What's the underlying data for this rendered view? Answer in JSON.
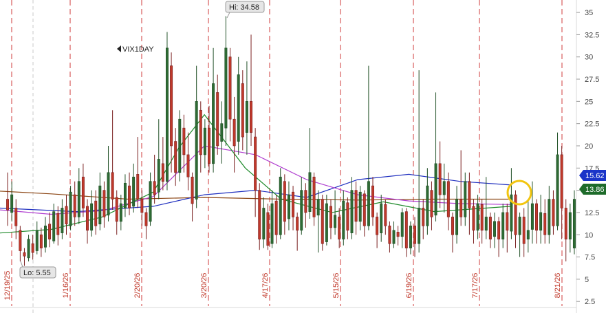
{
  "chart_data": {
    "type": "candlestick",
    "symbol": "VIX1DAY",
    "y_axis": {
      "ticks": [
        "35",
        "32.5",
        "30",
        "27.5",
        "25",
        "22.5",
        "20",
        "17.5",
        "15",
        "12.5",
        "10",
        "7.5",
        "5",
        "2.5"
      ],
      "ylim": [
        1.2,
        36.4
      ]
    },
    "date_markers": [
      "12/19/25",
      "1/16/26",
      "2/20/26",
      "3/20/26",
      "4/17/26",
      "5/15/26",
      "6/19/26",
      "7/17/26",
      "8/21/26"
    ],
    "hi_label": "Hi: 34.58",
    "lo_label": "Lo: 5.55",
    "price_tags": [
      {
        "text": "15.62",
        "value": 15.62,
        "color": "#1a35c8"
      },
      {
        "text": "13.86",
        "value": 13.86,
        "color": "#1e6b2a"
      }
    ],
    "moving_averages": [
      {
        "color": "#8b4513",
        "points": [
          [
            0,
            14.9
          ],
          [
            0.1,
            14.6
          ],
          [
            0.25,
            14.0
          ],
          [
            0.4,
            14.2
          ],
          [
            0.55,
            14.0
          ],
          [
            0.7,
            13.9
          ],
          [
            0.85,
            14.0
          ],
          [
            1,
            14.0
          ]
        ]
      },
      {
        "color": "#1f2fbf",
        "points": [
          [
            0,
            13.0
          ],
          [
            0.15,
            12.6
          ],
          [
            0.3,
            13.2
          ],
          [
            0.4,
            14.5
          ],
          [
            0.5,
            15.0
          ],
          [
            0.6,
            14.2
          ],
          [
            0.7,
            16.2
          ],
          [
            0.8,
            16.8
          ],
          [
            0.9,
            16.0
          ],
          [
            1,
            15.6
          ]
        ]
      },
      {
        "color": "#b03fd0",
        "points": [
          [
            0,
            12.8
          ],
          [
            0.1,
            12.3
          ],
          [
            0.2,
            12.7
          ],
          [
            0.3,
            14.3
          ],
          [
            0.4,
            20.0
          ],
          [
            0.5,
            19.0
          ],
          [
            0.6,
            16.2
          ],
          [
            0.7,
            14.5
          ],
          [
            0.8,
            13.8
          ],
          [
            0.9,
            13.5
          ],
          [
            1,
            13.4
          ]
        ]
      },
      {
        "color": "#1e8a2a",
        "points": [
          [
            0,
            10.2
          ],
          [
            0.1,
            10.6
          ],
          [
            0.2,
            12.0
          ],
          [
            0.3,
            14.8
          ],
          [
            0.35,
            19.8
          ],
          [
            0.4,
            23.5
          ],
          [
            0.48,
            17.5
          ],
          [
            0.55,
            14.0
          ],
          [
            0.65,
            12.5
          ],
          [
            0.75,
            13.7
          ],
          [
            0.85,
            12.6
          ],
          [
            0.95,
            13.0
          ],
          [
            1,
            13.2
          ]
        ]
      }
    ],
    "candles": [
      [
        14.0,
        12.8,
        17.0,
        11.0
      ],
      [
        12.5,
        14.5,
        16.0,
        11.5
      ],
      [
        13.0,
        11.0,
        14.0,
        9.5
      ],
      [
        10.5,
        8.2,
        11.0,
        7.0
      ],
      [
        8.0,
        7.6,
        8.5,
        6.5
      ],
      [
        7.4,
        9.5,
        10.0,
        7.0
      ],
      [
        9.0,
        8.0,
        10.0,
        7.2
      ],
      [
        8.2,
        10.5,
        11.5,
        7.8
      ],
      [
        10.0,
        8.5,
        10.8,
        7.5
      ],
      [
        8.6,
        11.0,
        12.0,
        8.0
      ],
      [
        11.2,
        9.5,
        12.5,
        8.6
      ],
      [
        9.3,
        12.6,
        13.5,
        9.0
      ],
      [
        12.4,
        10.0,
        13.2,
        8.8
      ],
      [
        10.2,
        13.0,
        14.0,
        9.5
      ],
      [
        13.2,
        11.2,
        14.5,
        10.0
      ],
      [
        11.0,
        14.8,
        15.5,
        10.5
      ],
      [
        14.5,
        12.0,
        16.0,
        11.0
      ],
      [
        12.0,
        16.0,
        17.5,
        11.2
      ],
      [
        16.5,
        13.0,
        18.0,
        12.0
      ],
      [
        13.2,
        10.5,
        14.0,
        9.0
      ],
      [
        10.5,
        13.5,
        15.0,
        9.8
      ],
      [
        13.8,
        11.0,
        15.0,
        10.0
      ],
      [
        11.2,
        15.5,
        17.0,
        10.5
      ],
      [
        15.0,
        12.0,
        16.0,
        10.8
      ],
      [
        12.2,
        17.0,
        20.0,
        11.5
      ],
      [
        17.0,
        14.0,
        24.0,
        12.8
      ],
      [
        14.2,
        11.5,
        15.0,
        10.0
      ],
      [
        11.5,
        13.5,
        14.5,
        10.5
      ],
      [
        13.0,
        15.8,
        16.8,
        12.0
      ],
      [
        15.5,
        13.0,
        17.0,
        12.2
      ],
      [
        13.2,
        16.5,
        18.0,
        12.5
      ],
      [
        16.8,
        14.0,
        21.0,
        13.0
      ],
      [
        14.0,
        12.5,
        15.0,
        11.0
      ],
      [
        12.5,
        11.0,
        13.0,
        9.5
      ],
      [
        11.5,
        16.0,
        17.0,
        11.0
      ],
      [
        16.0,
        14.5,
        19.0,
        13.5
      ],
      [
        14.8,
        18.5,
        23.0,
        14.0
      ],
      [
        18.0,
        16.0,
        21.0,
        15.0
      ],
      [
        16.0,
        31.0,
        32.8,
        15.0
      ],
      [
        29.0,
        20.0,
        30.5,
        17.0
      ],
      [
        20.5,
        17.0,
        22.0,
        15.5
      ],
      [
        17.0,
        23.0,
        24.0,
        16.0
      ],
      [
        22.0,
        19.0,
        23.5,
        17.0
      ],
      [
        19.0,
        16.5,
        21.5,
        15.0
      ],
      [
        16.5,
        13.5,
        17.0,
        11.5
      ],
      [
        14.0,
        25.0,
        29.0,
        13.0
      ],
      [
        24.0,
        19.0,
        25.0,
        17.0
      ],
      [
        19.0,
        22.0,
        23.0,
        17.5
      ],
      [
        22.0,
        18.0,
        24.5,
        17.0
      ],
      [
        18.0,
        27.0,
        31.0,
        17.0
      ],
      [
        26.0,
        20.0,
        28.0,
        19.0
      ],
      [
        20.5,
        22.5,
        25.0,
        18.0
      ],
      [
        22.0,
        31.0,
        34.58,
        20.0
      ],
      [
        30.0,
        23.0,
        31.0,
        20.5
      ],
      [
        23.0,
        20.0,
        25.5,
        17.0
      ],
      [
        20.5,
        28.0,
        30.0,
        19.0
      ],
      [
        27.0,
        21.0,
        28.5,
        19.5
      ],
      [
        21.5,
        25.0,
        29.5,
        19.0
      ],
      [
        25.0,
        21.5,
        32.5,
        20.0
      ],
      [
        21.0,
        15.0,
        22.0,
        12.0
      ],
      [
        15.0,
        9.5,
        15.8,
        8.3
      ],
      [
        9.5,
        13.0,
        14.2,
        8.5
      ],
      [
        12.5,
        8.8,
        13.5,
        8.3
      ],
      [
        9.0,
        13.5,
        15.0,
        8.5
      ],
      [
        13.8,
        10.0,
        14.5,
        9.0
      ],
      [
        10.0,
        16.5,
        17.5,
        9.5
      ],
      [
        16.0,
        11.5,
        16.8,
        10.0
      ],
      [
        11.8,
        14.5,
        16.0,
        10.5
      ],
      [
        14.8,
        12.0,
        15.5,
        10.5
      ],
      [
        12.0,
        10.5,
        12.5,
        8.2
      ],
      [
        10.5,
        15.0,
        16.5,
        10.0
      ],
      [
        15.0,
        12.5,
        15.8,
        10.8
      ],
      [
        12.6,
        17.0,
        22.0,
        11.8
      ],
      [
        16.5,
        12.0,
        17.0,
        11.0
      ],
      [
        12.2,
        14.0,
        15.0,
        8.0
      ],
      [
        14.0,
        9.0,
        14.5,
        8.2
      ],
      [
        9.2,
        13.5,
        14.5,
        8.8
      ],
      [
        13.2,
        10.8,
        14.0,
        9.5
      ],
      [
        10.8,
        12.2,
        15.0,
        10.0
      ],
      [
        12.0,
        9.5,
        13.0,
        8.5
      ],
      [
        9.5,
        13.8,
        15.0,
        8.8
      ],
      [
        13.6,
        10.5,
        14.2,
        9.5
      ],
      [
        10.2,
        15.0,
        16.5,
        9.5
      ],
      [
        15.0,
        11.5,
        16.0,
        10.0
      ],
      [
        11.5,
        14.8,
        15.5,
        10.5
      ],
      [
        14.6,
        11.0,
        15.0,
        9.8
      ],
      [
        11.0,
        16.0,
        29.0,
        10.5
      ],
      [
        15.5,
        12.0,
        16.5,
        11.0
      ],
      [
        12.0,
        10.0,
        12.5,
        8.5
      ],
      [
        10.2,
        13.5,
        14.5,
        9.2
      ],
      [
        13.4,
        11.0,
        14.0,
        10.0
      ],
      [
        11.0,
        9.0,
        11.5,
        8.0
      ],
      [
        9.0,
        10.5,
        11.5,
        8.5
      ],
      [
        10.3,
        9.8,
        11.0,
        8.8
      ],
      [
        9.8,
        12.5,
        13.0,
        8.5
      ],
      [
        12.6,
        8.5,
        13.0,
        7.5
      ],
      [
        8.5,
        11.0,
        11.5,
        7.8
      ],
      [
        11.0,
        9.0,
        12.0,
        7.5
      ],
      [
        9.0,
        13.0,
        28.5,
        8.0
      ],
      [
        13.0,
        11.0,
        14.0,
        9.5
      ],
      [
        11.0,
        15.5,
        17.5,
        10.0
      ],
      [
        15.0,
        12.0,
        16.0,
        10.5
      ],
      [
        12.2,
        18.0,
        26.0,
        11.5
      ],
      [
        18.0,
        14.5,
        20.5,
        13.0
      ],
      [
        14.5,
        16.0,
        18.0,
        12.5
      ],
      [
        16.0,
        12.0,
        17.0,
        10.5
      ],
      [
        12.0,
        10.0,
        12.5,
        8.0
      ],
      [
        10.0,
        14.0,
        15.5,
        9.0
      ],
      [
        14.0,
        12.0,
        19.5,
        11.0
      ],
      [
        12.0,
        16.0,
        17.0,
        11.0
      ],
      [
        16.0,
        13.0,
        17.0,
        10.0
      ],
      [
        13.2,
        10.5,
        14.0,
        9.0
      ],
      [
        10.5,
        13.5,
        14.5,
        9.5
      ],
      [
        13.4,
        10.5,
        14.0,
        9.0
      ],
      [
        10.5,
        12.0,
        16.5,
        9.5
      ],
      [
        12.0,
        9.5,
        12.5,
        8.5
      ],
      [
        9.8,
        11.5,
        12.5,
        8.5
      ],
      [
        11.5,
        9.5,
        12.0,
        7.5
      ],
      [
        9.5,
        12.5,
        13.5,
        8.5
      ],
      [
        12.5,
        10.5,
        13.5,
        8.0
      ],
      [
        10.4,
        14.5,
        17.5,
        9.5
      ],
      [
        14.5,
        10.0,
        15.0,
        8.5
      ],
      [
        10.0,
        12.0,
        12.5,
        7.5
      ],
      [
        12.0,
        9.0,
        13.0,
        7.5
      ],
      [
        9.5,
        10.5,
        14.0,
        8.0
      ],
      [
        10.6,
        13.5,
        16.0,
        9.0
      ],
      [
        13.5,
        10.5,
        14.0,
        9.0
      ],
      [
        10.5,
        12.5,
        14.5,
        9.0
      ],
      [
        12.4,
        10.0,
        14.0,
        9.0
      ],
      [
        10.0,
        14.0,
        15.5,
        9.0
      ],
      [
        14.0,
        11.0,
        15.0,
        10.0
      ],
      [
        11.0,
        19.0,
        21.5,
        10.5
      ],
      [
        19.0,
        13.0,
        20.0,
        9.5
      ],
      [
        13.0,
        9.5,
        14.0,
        7.0
      ],
      [
        9.5,
        12.5,
        13.5,
        8.0
      ],
      [
        8.5,
        14.0,
        15.0,
        7.8
      ]
    ],
    "highlight_circle": {
      "x_index": 134,
      "value": 13.5
    }
  }
}
